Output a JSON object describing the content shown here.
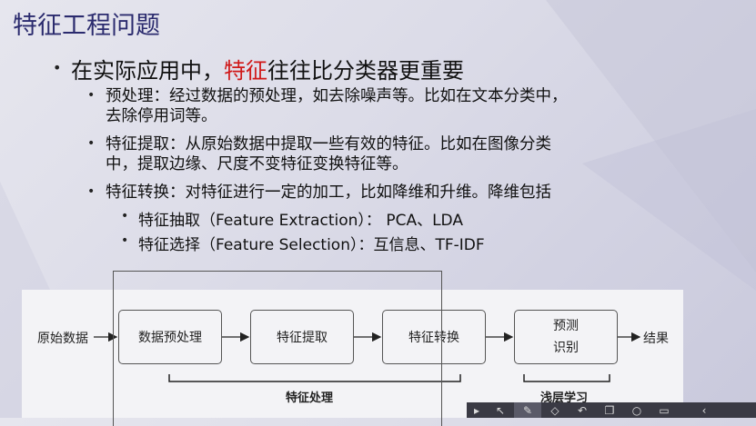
{
  "slide": {
    "title": "特征工程问题",
    "main_point": {
      "prefix": "在实际应用中，",
      "highlight": "特征",
      "suffix": "往往比分类器更重要"
    },
    "sub_points": [
      {
        "line1": "预处理：经过数据的预处理，如去除噪声等。比如在文本分类中，",
        "line2": "去除停用词等。"
      },
      {
        "line1": "特征提取：从原始数据中提取一些有效的特征。比如在图像分类",
        "line2": "中，提取边缘、尺度不变特征变换特征等。"
      },
      {
        "line1": "特征转换：对特征进行一定的加工，比如降维和升维。降维包括",
        "line2": ""
      }
    ],
    "sub_sub_points": [
      "特征抽取（Feature Extraction）： PCA、LDA",
      "特征选择（Feature Selection）：互信息、TF-IDF"
    ]
  },
  "diagram": {
    "input_label": "原始数据",
    "boxes": [
      "数据预处理",
      "特征提取",
      "特征转换"
    ],
    "predict_line1": "预测",
    "predict_line2": "识别",
    "output_label": "结果",
    "brace_feature": "特征处理",
    "brace_shallow": "浅层学习"
  },
  "toolbar": {
    "icons": [
      "play-icon",
      "pointer-icon",
      "pen-icon",
      "eraser-icon",
      "undo-icon",
      "copy-icon",
      "zoom-icon",
      "screen-icon",
      "back-icon"
    ]
  },
  "colors": {
    "title": "#2b2b6e",
    "highlight": "#d01818"
  }
}
